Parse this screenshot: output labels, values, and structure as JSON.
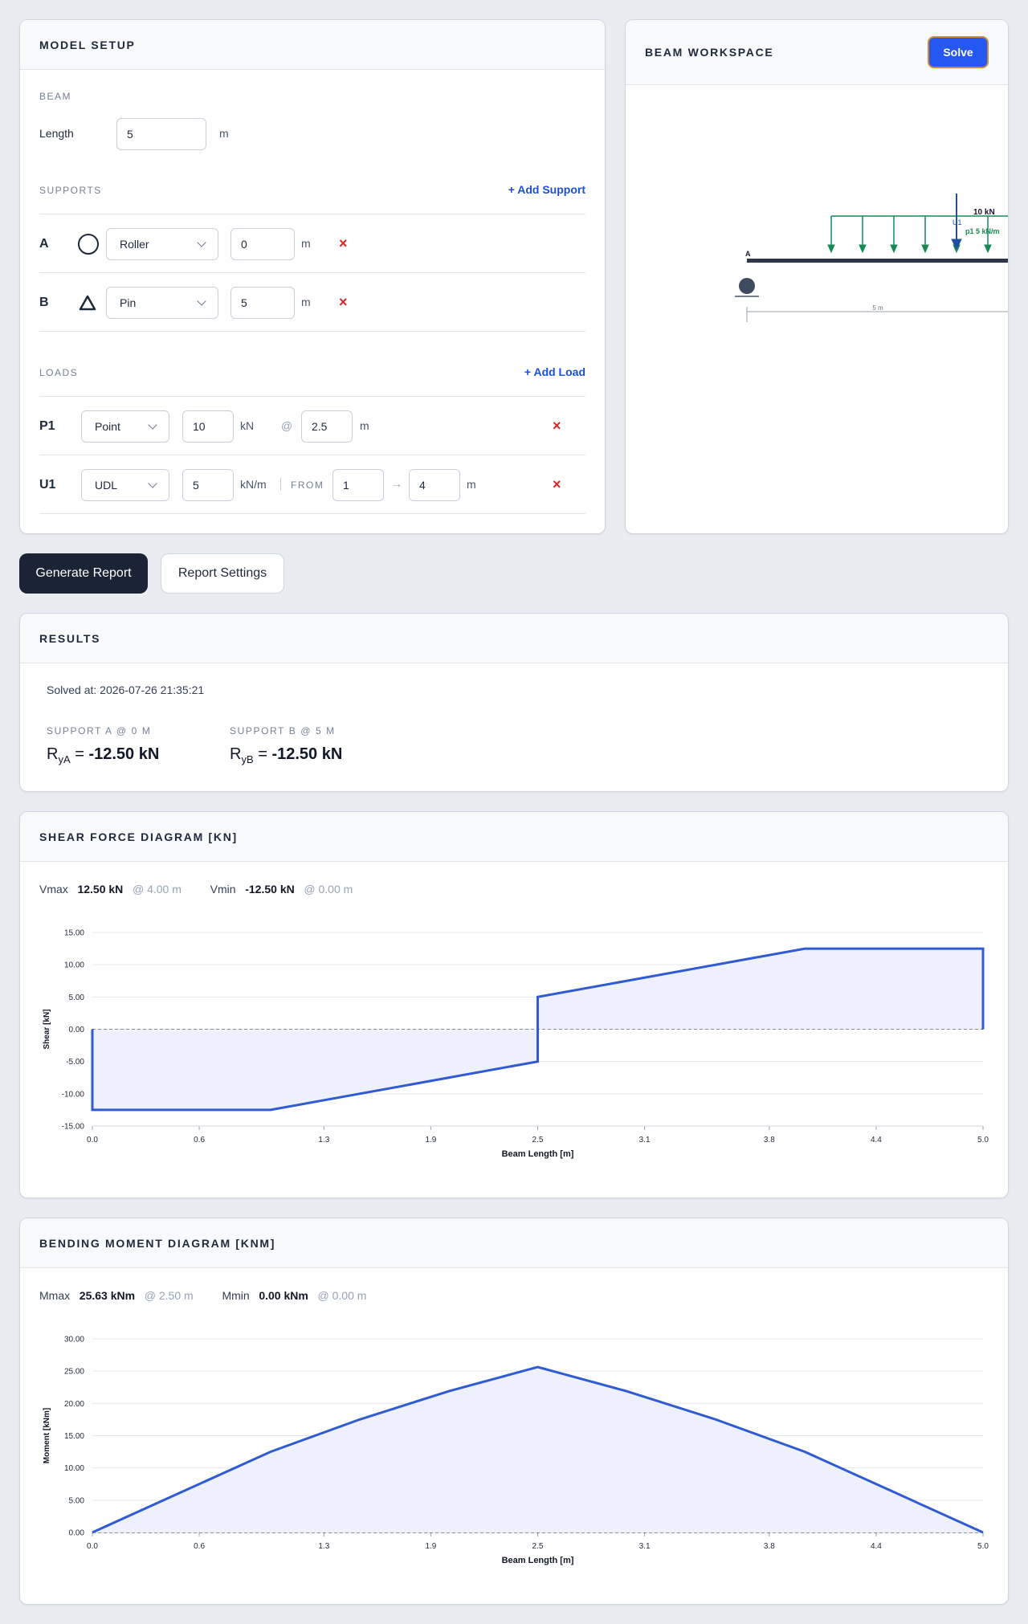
{
  "model_setup": {
    "title": "MODEL SETUP",
    "beam": {
      "section": "BEAM",
      "length_label": "Length",
      "length_value": "5",
      "length_unit": "m"
    },
    "supports": {
      "section": "SUPPORTS",
      "add_label": "+ Add Support",
      "items": [
        {
          "id": "A",
          "icon": "roller-circle-icon",
          "type": "Roller",
          "position": "0",
          "unit": "m",
          "remove": "×"
        },
        {
          "id": "B",
          "icon": "pin-triangle-icon",
          "type": "Pin",
          "position": "5",
          "unit": "m",
          "remove": "×"
        }
      ]
    },
    "loads": {
      "section": "LOADS",
      "add_label": "+ Add Load",
      "items": [
        {
          "id": "P1",
          "type": "Point",
          "magnitude": "10",
          "unit": "kN",
          "at_symbol": "@",
          "position": "2.5",
          "pos_unit": "m",
          "remove": "×"
        },
        {
          "id": "U1",
          "type": "UDL",
          "magnitude": "5",
          "unit": "kN/m",
          "from_label": "FROM",
          "start": "1",
          "arrow": "→",
          "end": "4",
          "pos_unit": "m",
          "remove": "×"
        }
      ]
    }
  },
  "workspace": {
    "title": "BEAM WORKSPACE",
    "solve_label": "Solve",
    "drawing": {
      "support_a_label": "A",
      "point_load_label": "10 kN",
      "udl_id_label": "U1",
      "udl_label": "p1 5 kN/m",
      "dimension_label": "5 m"
    },
    "colors": {
      "udl": "#178a55",
      "point": "#1e4fa3",
      "beam": "#2d3748"
    }
  },
  "actions": {
    "generate_report": "Generate Report",
    "report_settings": "Report Settings"
  },
  "results": {
    "title": "RESULTS",
    "solved_at": "Solved at: 2026-07-26 21:35:21",
    "reactions": [
      {
        "label": "SUPPORT A @ 0 M",
        "symbol": "R",
        "sub": "yA",
        "equals": "=",
        "value": "-12.50 kN"
      },
      {
        "label": "SUPPORT B @ 5 M",
        "symbol": "R",
        "sub": "yB",
        "equals": "=",
        "value": "-12.50 kN"
      }
    ]
  },
  "shear": {
    "title": "SHEAR FORCE DIAGRAM [KN]",
    "max_label": "Vmax",
    "max_value": "12.50 kN",
    "max_at": "@ 4.00 m",
    "min_label": "Vmin",
    "min_value": "-12.50 kN",
    "min_at": "@ 0.00 m"
  },
  "moment": {
    "title": "BENDING MOMENT DIAGRAM [KNM]",
    "max_label": "Mmax",
    "max_value": "25.63 kNm",
    "max_at": "@ 2.50 m",
    "min_label": "Mmin",
    "min_value": "0.00 kNm",
    "min_at": "@ 0.00 m"
  },
  "chart_data": [
    {
      "type": "area",
      "title": "SHEAR FORCE DIAGRAM [KN]",
      "xlabel": "Beam Length [m]",
      "ylabel": "Shear [kN]",
      "xlim": [
        0,
        5
      ],
      "ylim": [
        -15,
        15
      ],
      "x_ticks": [
        "0.0",
        "0.6",
        "1.3",
        "1.9",
        "2.5",
        "3.1",
        "3.8",
        "4.4",
        "5.0"
      ],
      "y_ticks": [
        "15.00",
        "10.00",
        "5.00",
        "0.00",
        "-5.00",
        "-10.00",
        "-15.00"
      ],
      "grid": true,
      "color": "#2f5bd3",
      "fill": "#eef1fb",
      "series": [
        {
          "x": [
            0,
            0,
            1,
            2.5,
            2.5,
            4,
            5,
            5
          ],
          "y": [
            0,
            -12.5,
            -12.5,
            -5,
            5,
            12.5,
            12.5,
            0
          ]
        }
      ]
    },
    {
      "type": "area",
      "title": "BENDING MOMENT DIAGRAM [KNM]",
      "xlabel": "Beam Length [m]",
      "ylabel": "Moment [kNm]",
      "xlim": [
        0,
        5
      ],
      "ylim": [
        0,
        30
      ],
      "x_ticks": [
        "0.0",
        "0.6",
        "1.3",
        "1.9",
        "2.5",
        "3.1",
        "3.8",
        "4.4",
        "5.0"
      ],
      "y_ticks": [
        "30.00",
        "25.00",
        "20.00",
        "15.00",
        "10.00",
        "5.00",
        "0.00"
      ],
      "grid": true,
      "color": "#2f5bd3",
      "fill": "#eef1fb",
      "series": [
        {
          "x": [
            0,
            0.5,
            1,
            1.5,
            2,
            2.5,
            3,
            3.5,
            4,
            4.5,
            5
          ],
          "y": [
            0,
            6.25,
            12.5,
            17.5,
            21.88,
            25.63,
            21.88,
            17.5,
            12.5,
            6.25,
            0
          ]
        }
      ]
    }
  ]
}
